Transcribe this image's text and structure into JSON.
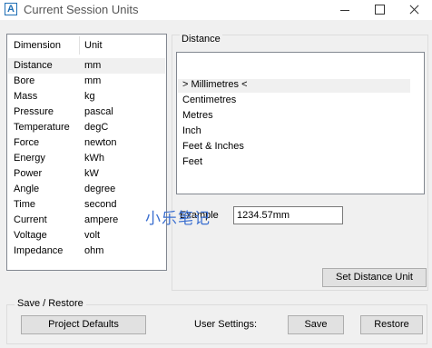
{
  "window": {
    "title": "Current Session Units",
    "icon_letter": "A"
  },
  "dimension_list": {
    "headers": [
      "Dimension",
      "Unit"
    ],
    "rows": [
      {
        "dimension": "Distance",
        "unit": "mm",
        "selected": true
      },
      {
        "dimension": "Bore",
        "unit": "mm"
      },
      {
        "dimension": "Mass",
        "unit": "kg"
      },
      {
        "dimension": "Pressure",
        "unit": "pascal"
      },
      {
        "dimension": "Temperature",
        "unit": "degC"
      },
      {
        "dimension": "Force",
        "unit": "newton"
      },
      {
        "dimension": "Energy",
        "unit": "kWh"
      },
      {
        "dimension": "Power",
        "unit": "kW"
      },
      {
        "dimension": "Angle",
        "unit": "degree"
      },
      {
        "dimension": "Time",
        "unit": "second"
      },
      {
        "dimension": "Current",
        "unit": "ampere"
      },
      {
        "dimension": "Voltage",
        "unit": "volt"
      },
      {
        "dimension": "Impedance",
        "unit": "ohm"
      }
    ]
  },
  "distance_panel": {
    "group_label": "Distance",
    "units": [
      {
        "label": "> Millimetres <",
        "selected": true
      },
      {
        "label": "Centimetres"
      },
      {
        "label": "Metres"
      },
      {
        "label": "Inch"
      },
      {
        "label": "Feet & Inches"
      },
      {
        "label": "Feet"
      }
    ],
    "example_label": "Example",
    "example_value": "1234.57mm",
    "set_button": "Set Distance Unit"
  },
  "watermark": "小乐笔记",
  "save_restore": {
    "group_label": "Save / Restore",
    "project_defaults_button": "Project Defaults",
    "user_settings_label": "User Settings:",
    "save_button": "Save",
    "restore_button": "Restore"
  }
}
